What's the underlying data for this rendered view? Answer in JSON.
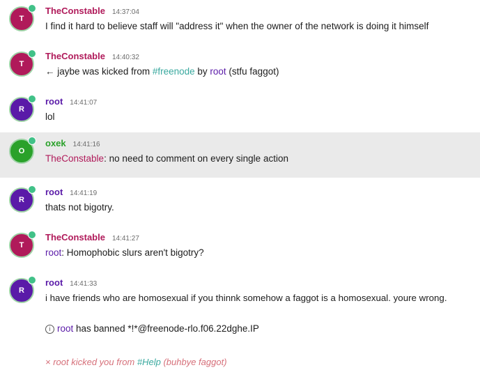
{
  "colors": {
    "TheConstable": "#b01a5a",
    "root": "#5a1aa8",
    "oxek": "#2aa12a",
    "channel": "#3aa99f",
    "kick": "#d6707a"
  },
  "messages": [
    {
      "initial": "T",
      "nick": "TheConstable",
      "time": "14:37:04",
      "text": "I find it hard to believe staff will \"address it\" when the owner of the network is doing it himself"
    },
    {
      "initial": "T",
      "nick": "TheConstable",
      "time": "14:40:32",
      "kick_arrow": "←",
      "kicked_user": "jaybe",
      "kick_phrase": " was kicked from ",
      "channel": "#freenode",
      "by_word": " by ",
      "kicker": "root",
      "reason": " (stfu faggot)"
    },
    {
      "initial": "R",
      "nick": "root",
      "time": "14:41:07",
      "text": "lol"
    },
    {
      "initial": "O",
      "nick": "oxek",
      "time": "14:41:16",
      "mention": "TheConstable",
      "text": ": no need to comment on every single action"
    },
    {
      "initial": "R",
      "nick": "root",
      "time": "14:41:19",
      "text": "thats not bigotry."
    },
    {
      "initial": "T",
      "nick": "TheConstable",
      "time": "14:41:27",
      "mention": "root",
      "text": ": Homophobic slurs aren't bigotry?"
    },
    {
      "initial": "R",
      "nick": "root",
      "time": "14:41:33",
      "text": "i have friends who are homosexual if you thinnk somehow a faggot is a homosexual.  youre wrong."
    }
  ],
  "ban_notice": {
    "icon": "i",
    "user": "root",
    "text": " has banned *!*@freenode-rlo.f06.22dghe.IP"
  },
  "kick_notice": {
    "icon": "×",
    "text_a": " root kicked you from ",
    "channel": "#Help",
    "text_b": " (buhbye faggot)"
  }
}
